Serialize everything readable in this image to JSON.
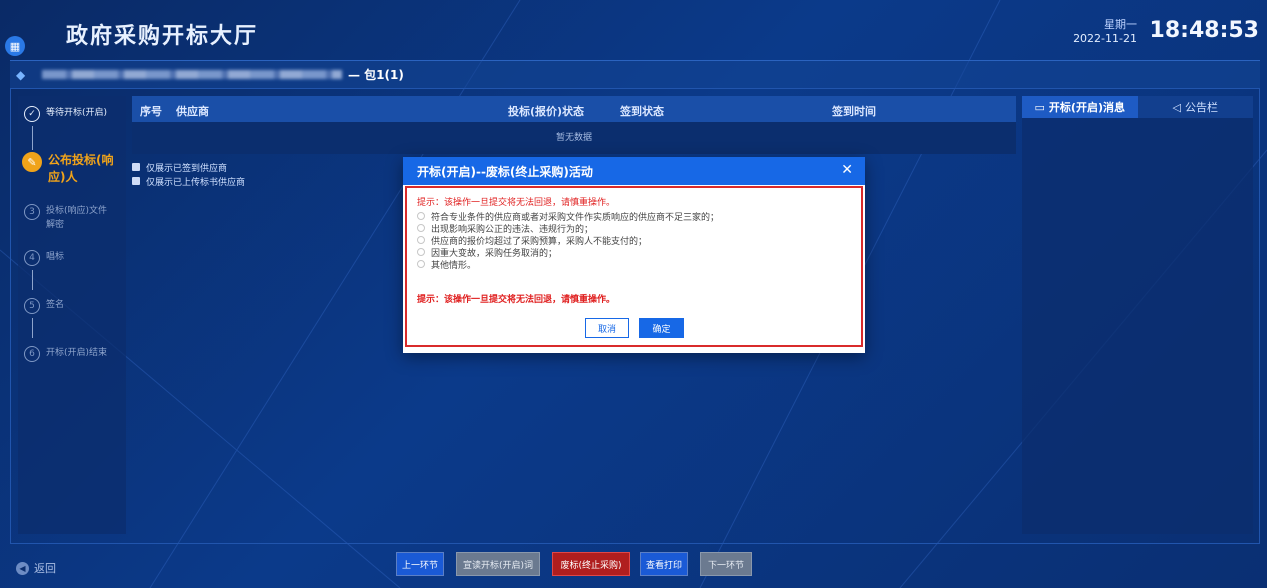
{
  "header": {
    "title": "政府采购开标大厅",
    "weekday": "星期一",
    "date": "2022-11-21",
    "time": "18:48:53"
  },
  "package": {
    "name": "— 包1(1)"
  },
  "steps": [
    {
      "num": "✓",
      "label": "等待开标(开启)",
      "state": "done"
    },
    {
      "num": "✎",
      "label": "公布投标(响应)人",
      "state": "active"
    },
    {
      "num": "3",
      "label": "投标(响应)文件解密",
      "state": "pending"
    },
    {
      "num": "4",
      "label": "唱标",
      "state": "pending"
    },
    {
      "num": "5",
      "label": "签名",
      "state": "pending"
    },
    {
      "num": "6",
      "label": "开标(开启)结束",
      "state": "pending"
    }
  ],
  "table": {
    "headers": [
      "序号",
      "供应商",
      "投标(报价)状态",
      "签到状态",
      "签到时间"
    ],
    "empty_text": "暂无数据"
  },
  "filters": [
    {
      "label": "仅展示已签到供应商",
      "checked": true
    },
    {
      "label": "仅展示已上传标书供应商",
      "checked": true
    }
  ],
  "right_tabs": [
    {
      "label": "开标(开启)消息",
      "icon": "message-icon",
      "active": true
    },
    {
      "label": "公告栏",
      "icon": "speaker-icon",
      "active": false
    }
  ],
  "bottom": {
    "back_label": "返回",
    "buttons": [
      "上一环节",
      "宣读开标(开启)词",
      "废标(终止采购)",
      "查看打印",
      "下一环节"
    ]
  },
  "modal": {
    "title": "开标(开启)--废标(终止采购)活动",
    "warning_top": "提示：该操作一旦提交将无法回退，请慎重操作。",
    "options": [
      "符合专业条件的供应商或者对采购文件作实质响应的供应商不足三家的；",
      "出现影响采购公正的违法、违规行为的；",
      "供应商的报价均超过了采购预算，采购人不能支付的；",
      "因重大变故，采购任务取消的；",
      "其他情形。"
    ],
    "warning_bottom": "提示：该操作一旦提交将无法回退，请慎重操作。",
    "cancel_label": "取消",
    "ok_label": "确定"
  },
  "colors": {
    "accent": "#1768e6",
    "active_step": "#f0a31a",
    "danger": "#b01e1e",
    "warning_text": "#e02020"
  }
}
